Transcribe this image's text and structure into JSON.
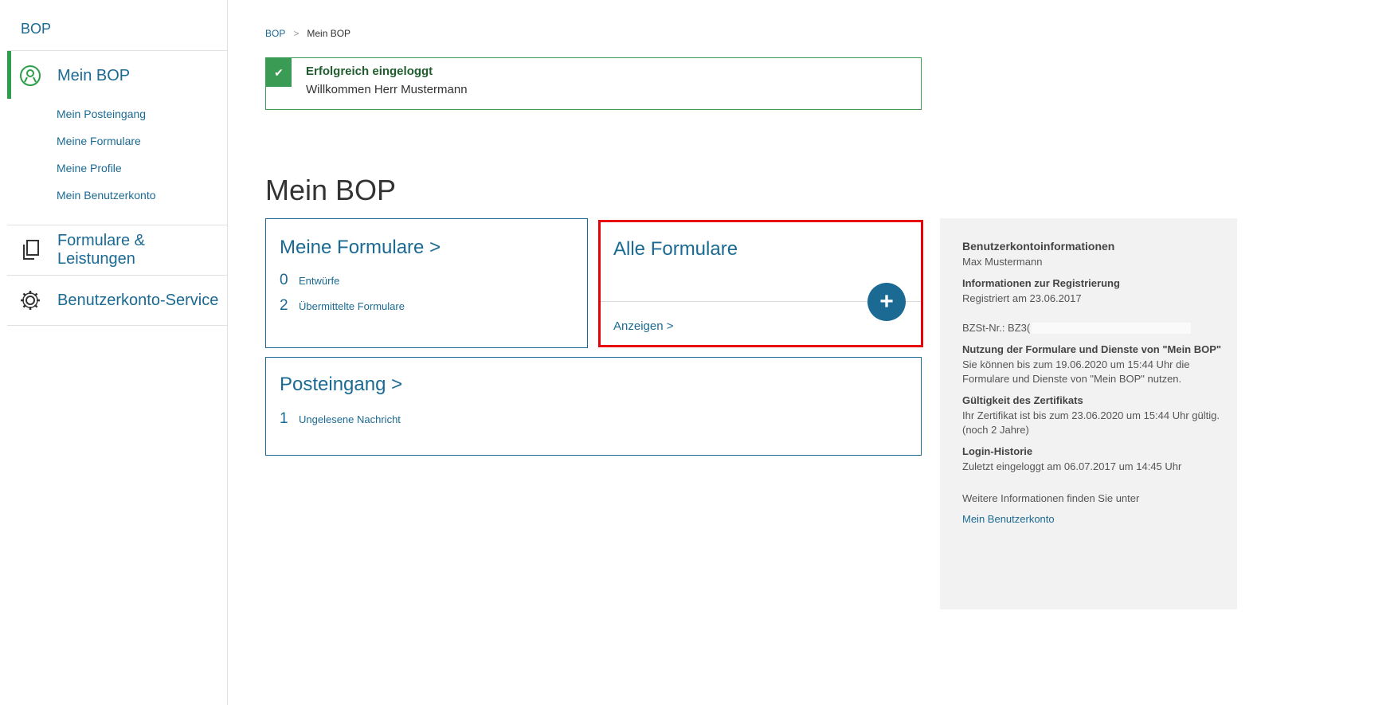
{
  "sidebar": {
    "top": "BOP",
    "sections": [
      {
        "label": "Mein BOP",
        "sub": [
          "Mein Posteingang",
          "Meine Formulare",
          "Meine Profile",
          "Mein Benutzerkonto"
        ]
      },
      {
        "label": "Formulare & Leistungen"
      },
      {
        "label": "Benutzerkonto-Service"
      }
    ]
  },
  "breadcrumb": {
    "home": "BOP",
    "sep": ">",
    "current": "Mein BOP"
  },
  "alert": {
    "check": "✔",
    "title": "Erfolgreich eingeloggt",
    "message": "Willkommen Herr Mustermann"
  },
  "page_title": "Mein BOP",
  "card_formulare": {
    "title": "Meine Formulare",
    "chev": ">",
    "drafts_count": "0",
    "drafts_label": "Entwürfe",
    "sent_count": "2",
    "sent_label": "Übermittelte Formulare"
  },
  "card_alle": {
    "title": "Alle Formulare",
    "show": "Anzeigen >",
    "plus": "+"
  },
  "card_post": {
    "title": "Posteingang",
    "chev": ">",
    "unread_count": "1",
    "unread_label": "Ungelesene Nachricht"
  },
  "info": {
    "account_title": "Benutzerkontoinformationen",
    "account_name": "Max Mustermann",
    "reg_title": "Informationen zur Registrierung",
    "reg_text": "Registriert am 23.06.2017",
    "bzst": "BZSt-Nr.: BZ3(",
    "usage_title": "Nutzung der Formulare und Dienste von \"Mein BOP\"",
    "usage_text": "Sie können bis zum 19.06.2020 um 15:44 Uhr die Formulare und Dienste von \"Mein BOP\" nutzen.",
    "cert_title": "Gültigkeit des Zertifikats",
    "cert_text": "Ihr Zertifikat ist bis zum 23.06.2020 um 15:44 Uhr gültig.",
    "cert_years": "(noch 2 Jahre)",
    "login_title": "Login-Historie",
    "login_text": "Zuletzt eingeloggt am 06.07.2017 um 14:45 Uhr",
    "more_text": "Weitere Informationen finden Sie unter",
    "more_link": "Mein Benutzerkonto"
  },
  "colors": {
    "brand": "#1b6a93",
    "success": "#3a9b55",
    "highlight": "#e8000b"
  }
}
